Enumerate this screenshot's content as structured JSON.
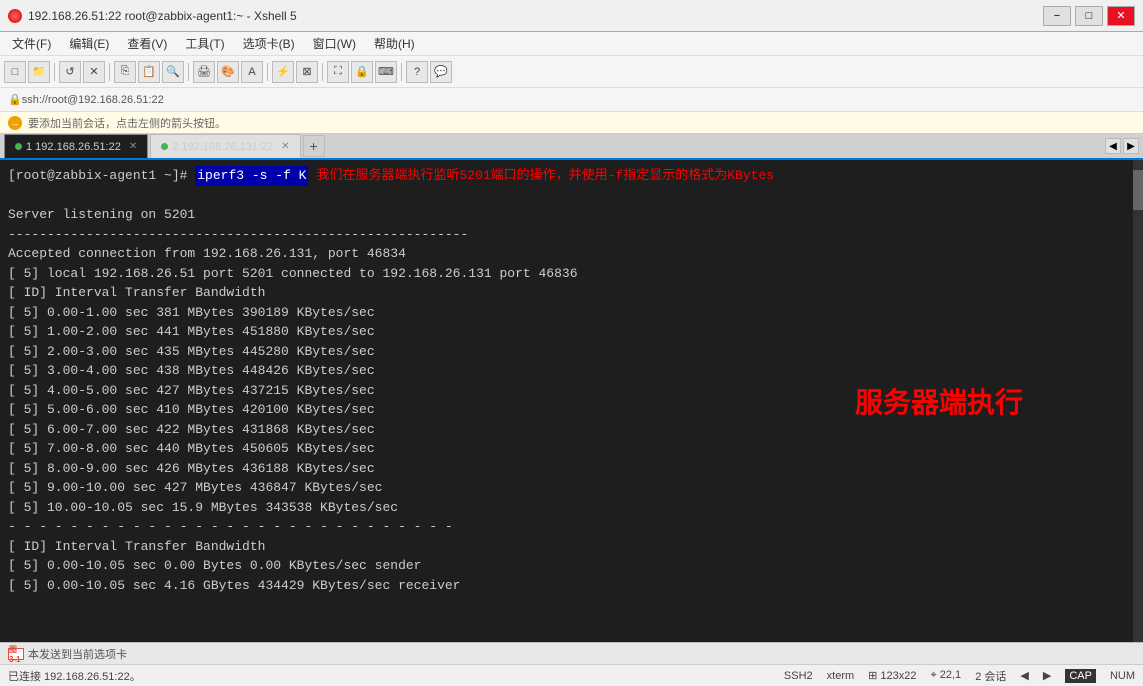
{
  "window": {
    "title": "192.168.26.51:22  root@zabbix-agent1:~ - Xshell 5",
    "icon_color": "#cc0000"
  },
  "menu": {
    "items": [
      "文件(F)",
      "编辑(E)",
      "查看(V)",
      "工具(T)",
      "选项卡(B)",
      "窗口(W)",
      "帮助(H)"
    ]
  },
  "address_bar": {
    "text": "ssh://root@192.168.26.51:22"
  },
  "info_bar": {
    "text": "要添加当前会话，点击左侧的箭头按钮。"
  },
  "tabs": [
    {
      "id": 1,
      "label": "1 192.168.26.51:22",
      "active": true
    },
    {
      "id": 2,
      "label": "2 192.168.26.131:22",
      "active": false
    }
  ],
  "terminal": {
    "prompt": "[root@zabbix-agent1 ~]#",
    "command": "iperf3 -s -f K",
    "annotation": "我们在服务器端执行监听5201端口的操作，并使用-f指定显示的格式为KBytes",
    "big_label": "服务器端执行",
    "lines": [
      "",
      "Server listening on 5201",
      "-----------------------------------------------------------",
      "Accepted connection from 192.168.26.131, port 46834",
      "[ 5] local 192.168.26.51 port 5201 connected to 192.168.26.131 port 46836",
      "[ ID] Interval           Transfer     Bandwidth",
      "[  5]   0.00-1.00   sec   381 MBytes   390189 KBytes/sec",
      "[  5]   1.00-2.00   sec   441 MBytes   451880 KBytes/sec",
      "[  5]   2.00-3.00   sec   435 MBytes   445280 KBytes/sec",
      "[  5]   3.00-4.00   sec   438 MBytes   448426 KBytes/sec",
      "[  5]   4.00-5.00   sec   427 MBytes   437215 KBytes/sec",
      "[  5]   5.00-6.00   sec   410 MBytes   420100 KBytes/sec",
      "[  5]   6.00-7.00   sec   422 MBytes   431868 KBytes/sec",
      "[  5]   7.00-8.00   sec   440 MBytes   450605 KBytes/sec",
      "[  5]   8.00-9.00   sec   426 MBytes   436188 KBytes/sec",
      "[  5]   9.00-10.00  sec   427 MBytes   436847 KBytes/sec",
      "[  5]  10.00-10.05  sec  15.9 MBytes   343538 KBytes/sec",
      "- - - - - - - - - - - - - - - - - - - - - - - - - - - - -",
      "[ ID] Interval           Transfer     Bandwidth",
      "[  5]   0.00-10.05  sec  0.00 Bytes    0.00 KBytes/sec                  sender",
      "[  5]   0.00-10.05  sec  4.16 GBytes  434429 KBytes/sec                  receiver"
    ]
  },
  "bottom_bar": {
    "icon_label": "图3-1",
    "text": "本发送到当前选项卡"
  },
  "status_bar": {
    "left": "已连接 192.168.26.51:22。",
    "ssh": "SSH2",
    "xterm": "xterm",
    "size": "123x22",
    "cursor": "22,1",
    "sessions": "2 会话",
    "cap": "CAP",
    "num": "NUM"
  }
}
